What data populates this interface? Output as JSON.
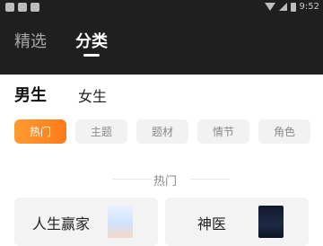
{
  "statusbar": {
    "time": "9:52"
  },
  "nav": {
    "tabs": [
      {
        "label": "精选"
      },
      {
        "label": "分类"
      }
    ]
  },
  "gender": {
    "male": "男生",
    "female": "女生"
  },
  "chips": [
    "热门",
    "主题",
    "题材",
    "情节",
    "角色"
  ],
  "section": {
    "title": "热门"
  },
  "cards": [
    {
      "title": "人生赢家"
    },
    {
      "title": "神医"
    }
  ],
  "colors": {
    "nav_bg": "#1f1f1f",
    "chip_active": "#ff8a25",
    "chip_bg": "#f2f2f2",
    "card_bg": "#f3f3f3"
  }
}
